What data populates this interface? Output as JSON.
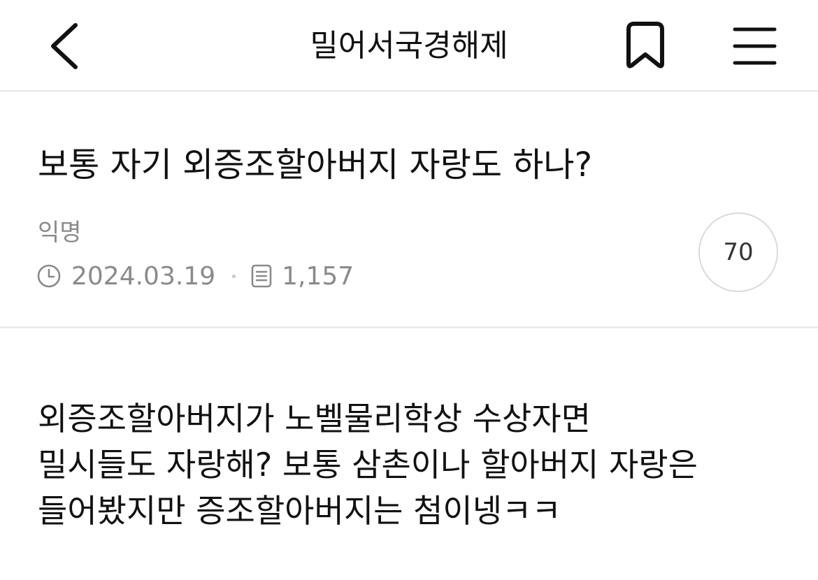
{
  "header": {
    "title": "밀어서국경해제",
    "back_icon": "chevron-left-icon",
    "bookmark_icon": "bookmark-icon",
    "menu_icon": "hamburger-menu-icon"
  },
  "post": {
    "title": "보통 자기 외증조할아버지 자랑도 하나?",
    "author": "익명",
    "date": "2024.03.19",
    "views": "1,157",
    "comment_count": "70",
    "body_lines": [
      "외증조할아버지가 노벨물리학상 수상자면",
      "밀시들도 자랑해? 보통 삼촌이나 할아버지 자랑은",
      "들어봤지만 증조할아버지는 첨이넹ㅋㅋ"
    ]
  },
  "colors": {
    "text_primary": "#111111",
    "text_secondary": "#8a8a8a",
    "divider": "#e6e6e6",
    "circle_border": "#dadada"
  }
}
